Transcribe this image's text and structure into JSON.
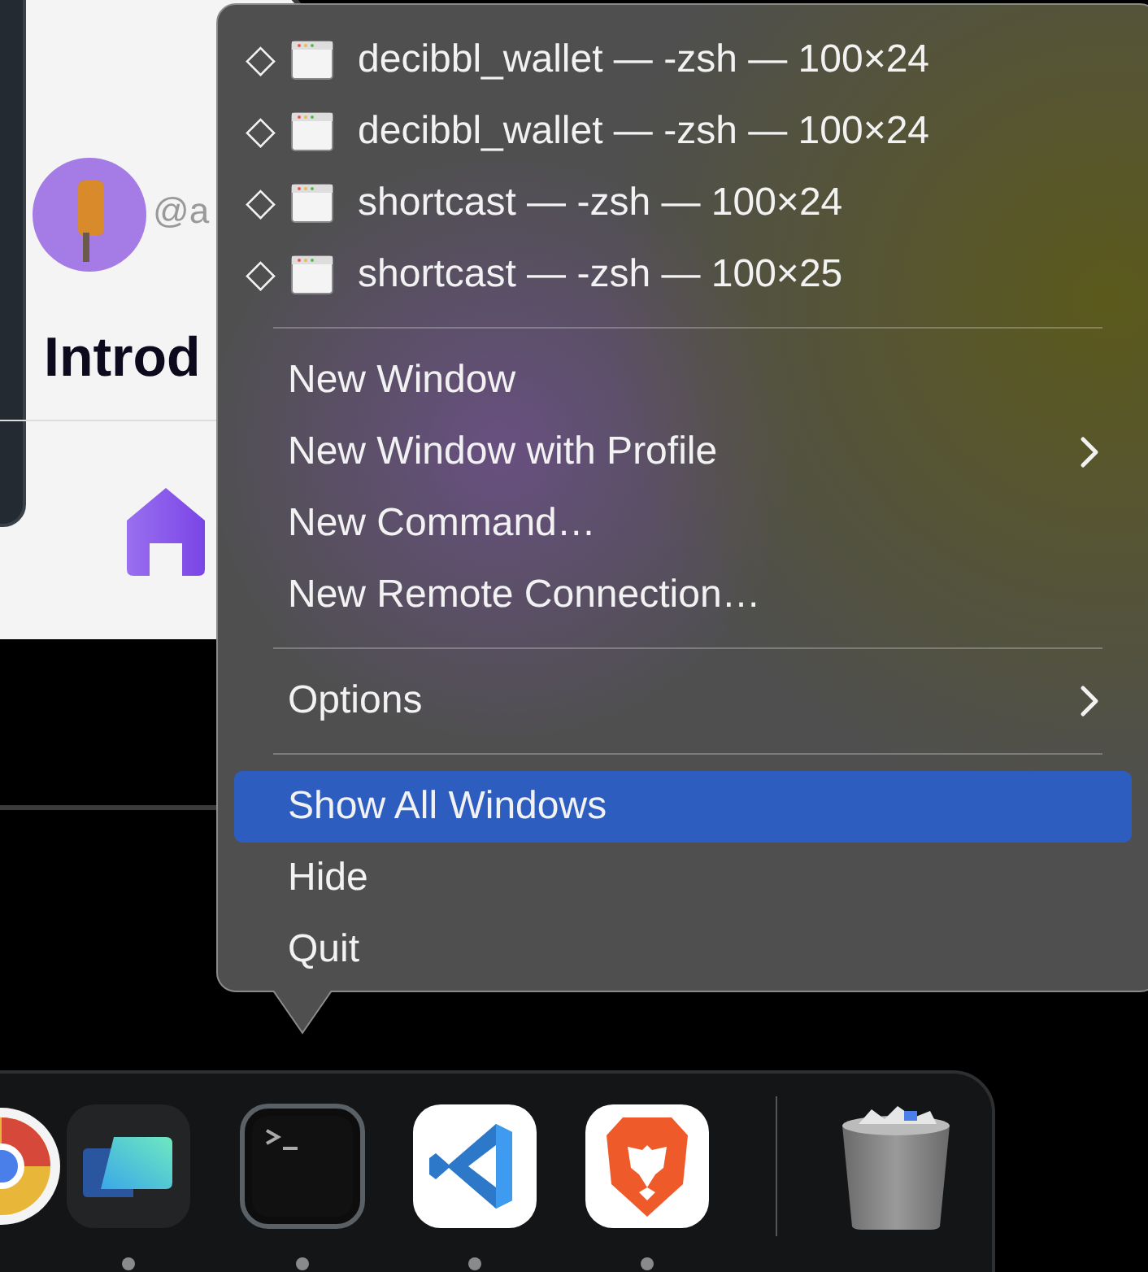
{
  "background_app": {
    "handle": "@a",
    "heading": "Introd"
  },
  "menu": {
    "windows": [
      {
        "mark": "◇",
        "title": "decibbl_wallet — -zsh — 100×24"
      },
      {
        "mark": "◇",
        "title": "decibbl_wallet — -zsh — 100×24"
      },
      {
        "mark": "◇",
        "title": "shortcast — -zsh — 100×24"
      },
      {
        "mark": "◇",
        "title": "shortcast — -zsh — 100×25"
      }
    ],
    "sections": [
      [
        {
          "label": "New Window",
          "submenu": false,
          "selected": false
        },
        {
          "label": "New Window with Profile",
          "submenu": true,
          "selected": false
        },
        {
          "label": "New Command…",
          "submenu": false,
          "selected": false
        },
        {
          "label": "New Remote Connection…",
          "submenu": false,
          "selected": false
        }
      ],
      [
        {
          "label": "Options",
          "submenu": true,
          "selected": false
        }
      ],
      [
        {
          "label": "Show All Windows",
          "submenu": false,
          "selected": true
        },
        {
          "label": "Hide",
          "submenu": false,
          "selected": false
        },
        {
          "label": "Quit",
          "submenu": false,
          "selected": false
        }
      ]
    ]
  },
  "dock": {
    "apps": [
      {
        "kind": "chrome",
        "running": false
      },
      {
        "kind": "cards",
        "running": true
      },
      {
        "kind": "terminal",
        "running": true
      },
      {
        "kind": "vscode",
        "running": true
      },
      {
        "kind": "brave",
        "running": true
      },
      {
        "kind": "trash",
        "running": false
      }
    ]
  }
}
